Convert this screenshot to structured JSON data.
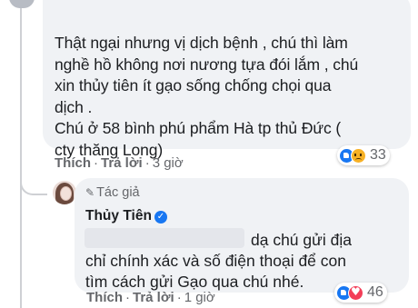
{
  "comment": {
    "lines": [
      "Thật ngại nhưng vị dịch bệnh , chú thì làm",
      "nghề hồ không nơi nương tựa đói lắm , chú",
      "xin thủy tiên ít gạo sống chống chọi qua",
      "dịch .",
      "Chú ở 58 bình phú phẩm Hà tp thủ Đức (",
      "cty thăng Long)"
    ],
    "reactions": {
      "icons": [
        "like-icon",
        "sad-icon"
      ],
      "count": "33"
    },
    "actions": {
      "like": "Thích",
      "reply": "Trả lời",
      "time": "3 giờ"
    }
  },
  "reply": {
    "author_badge": "Tác giả",
    "author_name": "Thủy Tiên",
    "lines": [
      "dạ chú gửi địa",
      "chỉ chính xác và số điện thoại để con",
      "tìm cách gửi Gạo qua chú nhé."
    ],
    "reactions": {
      "icons": [
        "like-icon",
        "love-icon"
      ],
      "count": "46"
    },
    "actions": {
      "like": "Thích",
      "reply": "Trả lời",
      "time": "1 giờ"
    }
  },
  "colors": {
    "bubble": "#f0f2f5",
    "meta_text": "#65676b",
    "like_blue": "#1877f2",
    "love_red": "#f33e58",
    "sad_yellow": "#f7b125"
  }
}
